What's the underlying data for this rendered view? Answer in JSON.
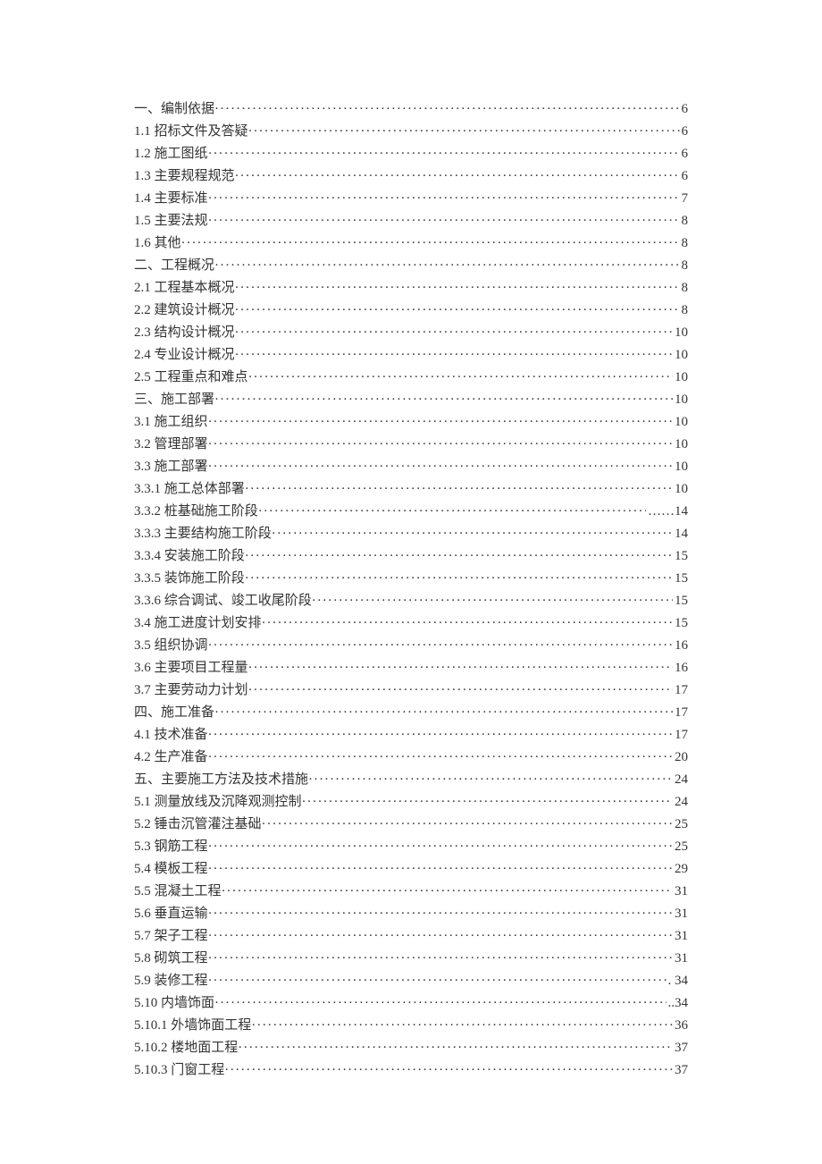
{
  "toc": [
    {
      "title": "一、编制依据",
      "page": " 6"
    },
    {
      "title": "1.1 招标文件及答疑",
      "page": "6"
    },
    {
      "title": "1.2 施工图纸",
      "page": "6"
    },
    {
      "title": "1.3 主要规程规范",
      "page": "6"
    },
    {
      "title": "1.4 主要标准",
      "page": "7"
    },
    {
      "title": "1.5 主要法规",
      "page": "8"
    },
    {
      "title": "1.6 其他",
      "page": "8"
    },
    {
      "title": "二、工程概况",
      "page": "8"
    },
    {
      "title": "2.1 工程基本概况",
      "page": "8"
    },
    {
      "title": "2.2 建筑设计概况",
      "page": "8"
    },
    {
      "title": "2.3 结构设计概况",
      "page": "10"
    },
    {
      "title": "2.4 专业设计概况",
      "page": "10"
    },
    {
      "title": "2.5 工程重点和难点",
      "page": "10"
    },
    {
      "title": "三、施工部署",
      "page": "10"
    },
    {
      "title": "3.1 施工组织",
      "page": "10"
    },
    {
      "title": "3.2 管理部署",
      "page": "10"
    },
    {
      "title": "3.3 施工部署",
      "page": "10"
    },
    {
      "title": "3.3.1 施工总体部署",
      "page": "10"
    },
    {
      "title": "3.3.2 桩基础施工阶段",
      "page": "……14"
    },
    {
      "title": "3.3.3 主要结构施工阶段",
      "page": "14"
    },
    {
      "title": "3.3.4 安装施工阶段",
      "page": "15"
    },
    {
      "title": "3.3.5 装饰施工阶段",
      "page": "15"
    },
    {
      "title": "3.3.6 综合调试、竣工收尾阶段",
      "page": "15"
    },
    {
      "title": "3.4 施工进度计划安排",
      "page": "15"
    },
    {
      "title": "3.5 组织协调",
      "page": "16"
    },
    {
      "title": "3.6 主要项目工程量",
      "page": "16"
    },
    {
      "title": "3.7 主要劳动力计划",
      "page": "17"
    },
    {
      "title": "四、施工准备",
      "page": "17"
    },
    {
      "title": "4.1 技术准备",
      "page": "17"
    },
    {
      "title": "4.2 生产准备",
      "page": "20"
    },
    {
      "title": "五、主要施工方法及技术措施",
      "page": "24"
    },
    {
      "title": "5.1 测量放线及沉降观测控制",
      "page": "24"
    },
    {
      "title": "5.2 锤击沉管灌注基础",
      "page": "25"
    },
    {
      "title": "5.3 钢筋工程",
      "page": "25"
    },
    {
      "title": "5.4 模板工程",
      "page": "29"
    },
    {
      "title": "5.5 混凝土工程",
      "page": "31"
    },
    {
      "title": "5.6 垂直运输",
      "page": "31"
    },
    {
      "title": "5.7 架子工程",
      "page": "31"
    },
    {
      "title": "5.8 砌筑工程",
      "page": "31"
    },
    {
      "title": "5.9 装修工程",
      "page": ". 34"
    },
    {
      "title": "5.10 内墙饰面",
      "page": " ..34"
    },
    {
      "title": "5.10.1 外墙饰面工程",
      "page": " 36"
    },
    {
      "title": "5.10.2 楼地面工程",
      "page": "37"
    },
    {
      "title": "5.10.3 门窗工程",
      "page": "37"
    }
  ]
}
